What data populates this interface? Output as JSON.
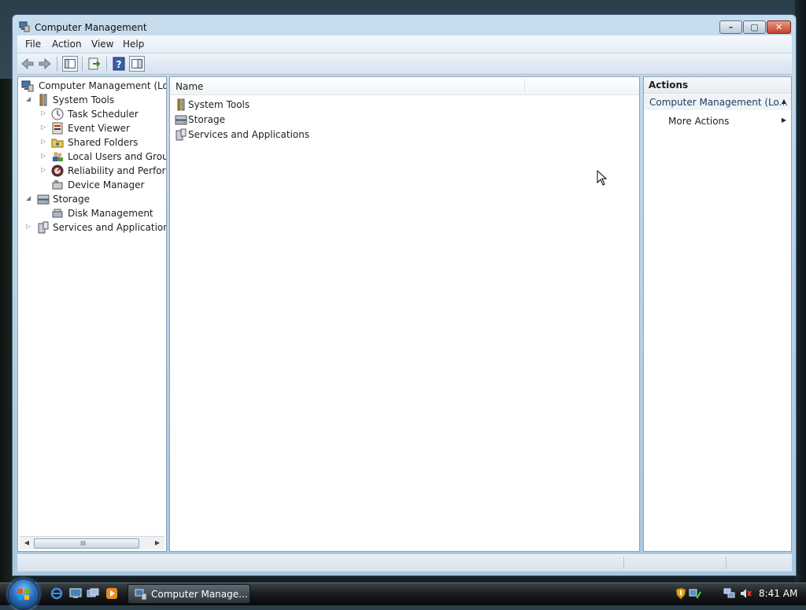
{
  "window": {
    "title": "Computer Management"
  },
  "menu": {
    "file": "File",
    "action": "Action",
    "view": "View",
    "help": "Help"
  },
  "tree": {
    "root": "Computer Management (Local",
    "system_tools": "System Tools",
    "task_scheduler": "Task Scheduler",
    "event_viewer": "Event Viewer",
    "shared_folders": "Shared Folders",
    "local_users": "Local Users and Groups",
    "reliability": "Reliability and Performa",
    "device_manager": "Device Manager",
    "storage": "Storage",
    "disk_management": "Disk Management",
    "services_apps": "Services and Applications"
  },
  "content": {
    "column_name": "Name",
    "items": [
      "System Tools",
      "Storage",
      "Services and Applications"
    ]
  },
  "actions": {
    "header": "Actions",
    "group": "Computer Management (Lo...",
    "more": "More Actions"
  },
  "taskbar": {
    "task_label": "Computer Manage...",
    "clock": "8:41 AM"
  },
  "colors": {
    "accent": "#2a6fba",
    "taskbar": "#1b1f22",
    "close": "#c2432b"
  }
}
